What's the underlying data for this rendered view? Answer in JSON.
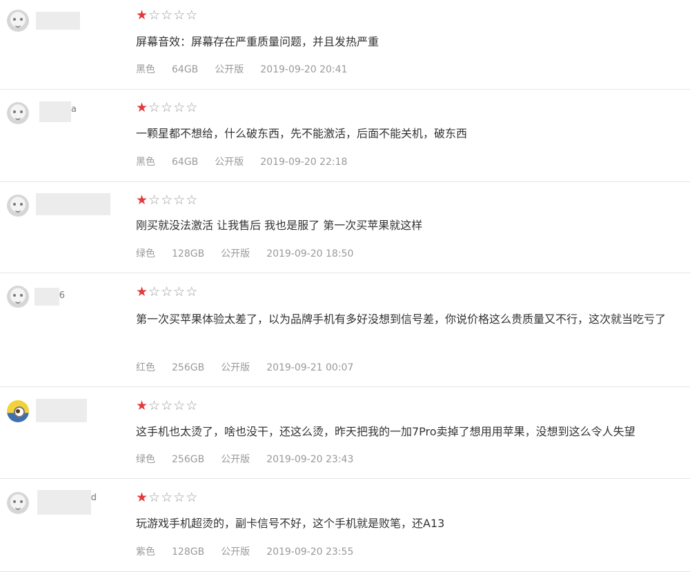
{
  "accent_color": "#e4393c",
  "icons": {
    "avatar_default": "default-avatar-face-icon",
    "avatar_minion": "minion-avatar-icon",
    "star_filled": "star-filled-icon",
    "star_empty": "star-empty-icon"
  },
  "reviews": [
    {
      "username_suffix": "",
      "rating": 1,
      "max_rating": 5,
      "content": "屏幕音效：屏幕存在严重质量问题，并且发热严重",
      "color": "黑色",
      "storage": "64GB",
      "edition": "公开版",
      "datetime": "2019-09-20 20:41"
    },
    {
      "username_suffix": "a",
      "rating": 1,
      "max_rating": 5,
      "content": "一颗星都不想给，什么破东西，先不能激活，后面不能关机，破东西",
      "color": "黑色",
      "storage": "64GB",
      "edition": "公开版",
      "datetime": "2019-09-20 22:18"
    },
    {
      "username_suffix": "",
      "rating": 1,
      "max_rating": 5,
      "content": "刚买就没法激活 让我售后 我也是服了 第一次买苹果就这样",
      "color": "绿色",
      "storage": "128GB",
      "edition": "公开版",
      "datetime": "2019-09-20 18:50"
    },
    {
      "username_suffix": "6",
      "rating": 1,
      "max_rating": 5,
      "content": "第一次买苹果体验太差了，以为品牌手机有多好没想到信号差，你说价格这么贵质量又不行，这次就当吃亏了",
      "color": "红色",
      "storage": "256GB",
      "edition": "公开版",
      "datetime": "2019-09-21 00:07"
    },
    {
      "username_suffix": "",
      "rating": 1,
      "max_rating": 5,
      "content": "这手机也太烫了，啥也没干，还这么烫，昨天把我的一加7Pro卖掉了想用用苹果，没想到这么令人失望",
      "color": "绿色",
      "storage": "256GB",
      "edition": "公开版",
      "datetime": "2019-09-20 23:43"
    },
    {
      "username_suffix": "d",
      "rating": 1,
      "max_rating": 5,
      "content": "玩游戏手机超烫的，副卡信号不好，这个手机就是败笔，还A13",
      "color": "紫色",
      "storage": "128GB",
      "edition": "公开版",
      "datetime": "2019-09-20 23:55"
    }
  ]
}
